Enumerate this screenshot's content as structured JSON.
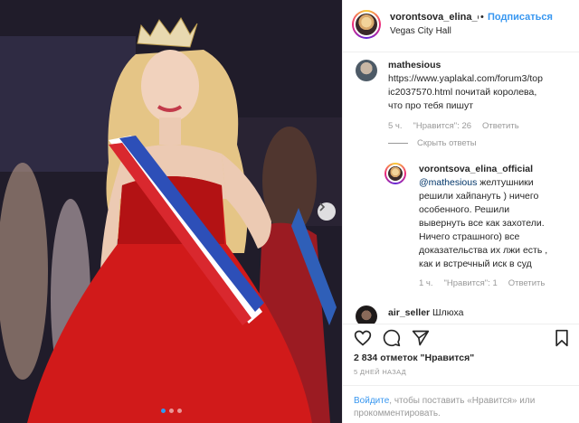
{
  "post": {
    "username": "vorontsova_elina_c",
    "separator": "•",
    "follow_label": "Подписаться",
    "location": "Vegas City Hall",
    "likes_text": "2 834 отметок \"Нравится\"",
    "date_text": "5 ДНЕЙ НАЗАД",
    "carousel_dots": 3,
    "carousel_active": 0
  },
  "comments": [
    {
      "username": "mathesious",
      "text_lines": [
        "https://www.yaplakal.com/forum3/top",
        "ic2037570.html почитай королева,",
        "что про тебя пишут"
      ],
      "time": "5 ч.",
      "likes": "\"Нравится\": 26",
      "reply_label": "Ответить",
      "hide_replies_label": "Скрыть ответы"
    },
    {
      "username": "vorontsova_elina_official",
      "mention": "@mathesious",
      "text_lines": [
        " желтушники",
        "решили хайпануть ) ничего",
        "особенного. Решили",
        "вывернуть все как захотели.",
        "Ничего страшного) все",
        "доказательства их лжи есть ,",
        "как и встречный иск в суд"
      ],
      "time": "1 ч.",
      "likes": "\"Нравится\": 1",
      "reply_label": "Ответить"
    },
    {
      "username": "air_seller",
      "text": "Шлюха"
    }
  ],
  "login_prompt": {
    "link": "Войдите",
    "text": ", чтобы поставить «Нравится» или прокомментировать."
  },
  "icons": [
    "heart-icon",
    "comment-icon",
    "share-icon",
    "bookmark-icon",
    "chevron-right-icon"
  ],
  "colors": {
    "accent": "#3897f0",
    "dress": "#d11a1a",
    "muted": "#999999"
  }
}
